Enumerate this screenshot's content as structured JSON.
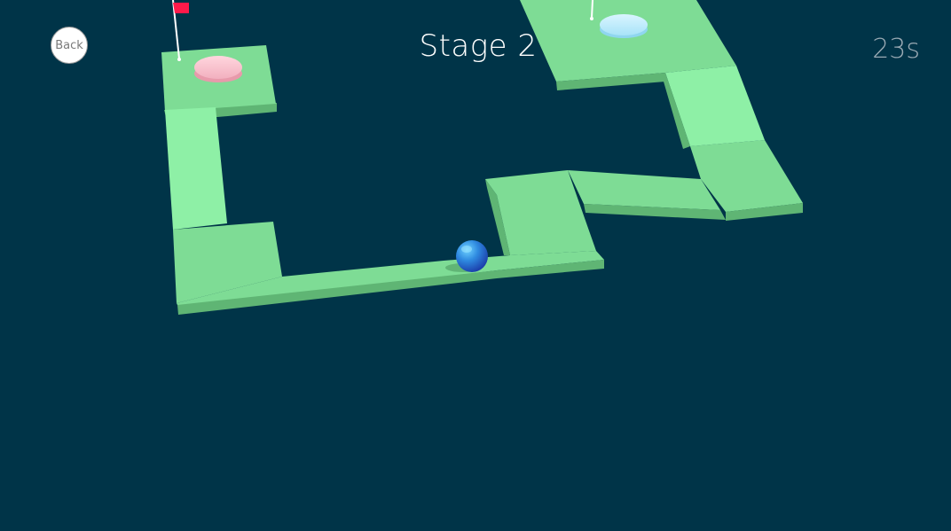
{
  "game": {
    "stage_title": "Stage 2",
    "timer": "23s",
    "back_label": "Back"
  },
  "colors": {
    "background": "#003448",
    "path_top": "#7edc95",
    "path_top_light": "#8ef0a6",
    "path_side": "#5fb574",
    "start_hole": "#f7c6d0",
    "goal_hole": "#bfe9fb",
    "flag": "#ff1a4a",
    "ball": "#2f8ae0"
  },
  "icons": {
    "back": "back-button-icon",
    "ball": "player-ball",
    "flag": "goal-flag-icon"
  }
}
